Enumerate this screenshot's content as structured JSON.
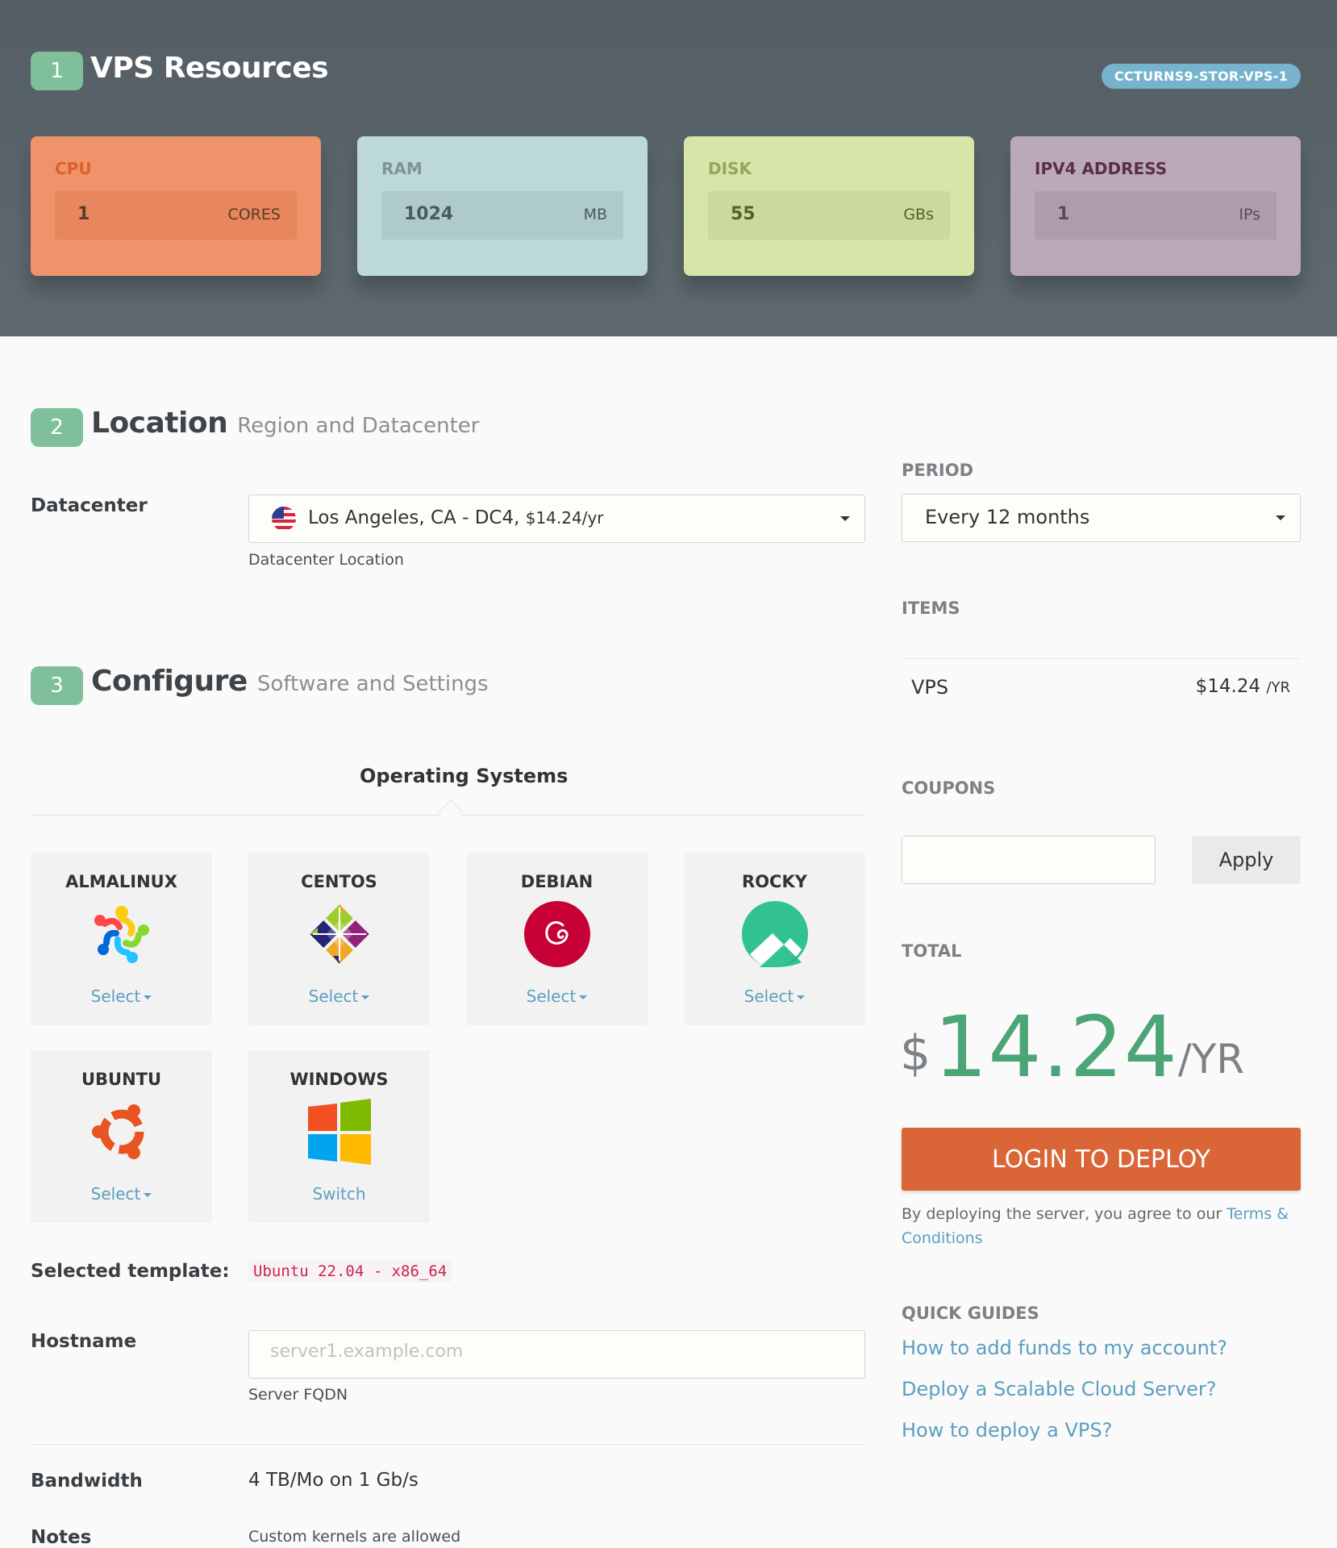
{
  "resources": {
    "step": "1",
    "title": "VPS Resources",
    "plan_code": "CCTURNS9-STOR-VPS-1",
    "cards": [
      {
        "label": "CPU",
        "value": "1",
        "unit": "CORES",
        "bg": "#f0936a",
        "box": "#e8865d",
        "label_color": "#d9622e",
        "text_color": "#5a3a2a"
      },
      {
        "label": "RAM",
        "value": "1024",
        "unit": "MB",
        "bg": "#bdd8d8",
        "box": "#afcaca",
        "label_color": "#7f9496",
        "text_color": "#4c5a5b"
      },
      {
        "label": "DISK",
        "value": "55",
        "unit": "GBs",
        "bg": "#d8e5a8",
        "box": "#ccd99c",
        "label_color": "#97a45a",
        "text_color": "#54602b"
      },
      {
        "label": "IPV4 ADDRESS",
        "value": "1",
        "unit": "IPs",
        "bg": "#bba9b8",
        "box": "#ae9cab",
        "label_color": "#5a2e4e",
        "text_color": "#5a4a57"
      }
    ]
  },
  "location": {
    "step": "2",
    "title": "Location",
    "subtitle": "Region and Datacenter",
    "datacenter_label": "Datacenter",
    "datacenter_value": "Los Angeles, CA - DC4,",
    "datacenter_price": "$14.24/yr",
    "datacenter_help": "Datacenter Location"
  },
  "configure": {
    "step": "3",
    "title": "Configure",
    "subtitle": "Software and Settings",
    "tab": "Operating Systems",
    "os": [
      {
        "name": "ALMALINUX",
        "action": "Select",
        "icon": "almalinux-icon"
      },
      {
        "name": "CENTOS",
        "action": "Select",
        "icon": "centos-icon"
      },
      {
        "name": "DEBIAN",
        "action": "Select",
        "icon": "debian-icon"
      },
      {
        "name": "ROCKY",
        "action": "Select",
        "icon": "rocky-icon"
      },
      {
        "name": "UBUNTU",
        "action": "Select",
        "icon": "ubuntu-icon"
      },
      {
        "name": "WINDOWS",
        "action": "Switch",
        "icon": "windows-icon"
      }
    ],
    "selected_template_label": "Selected template:",
    "selected_template_value": "Ubuntu 22.04 - x86_64",
    "hostname_label": "Hostname",
    "hostname_placeholder": "server1.example.com",
    "hostname_help": "Server FQDN",
    "bandwidth_label": "Bandwidth",
    "bandwidth_value": "4 TB/Mo on 1 Gb/s",
    "notes_label": "Notes",
    "notes_value": "Custom kernels are allowed"
  },
  "sidebar": {
    "period_label": "PERIOD",
    "period_value": "Every 12 months",
    "items_label": "ITEMS",
    "item_name": "VPS",
    "item_price": "$14.24",
    "item_unit": "/YR",
    "coupons_label": "COUPONS",
    "apply_label": "Apply",
    "total_label": "TOTAL",
    "total_currency": "$",
    "total_amount": "14.24",
    "total_unit": "/YR",
    "deploy_label": "LOGIN TO DEPLOY",
    "agree_text": "By deploying the server, you agree to our",
    "agree_link": "Terms & Conditions",
    "guides_label": "QUICK GUIDES",
    "guides": [
      "How to add funds to my account?",
      "Deploy a Scalable Cloud Server?",
      "How to deploy a VPS?"
    ]
  },
  "colors": {
    "accent_green": "#7fc09a",
    "price_green": "#4ba577",
    "link_blue": "#5b9fc0",
    "deploy_orange": "#da6637",
    "header_bg": "#545e64"
  }
}
